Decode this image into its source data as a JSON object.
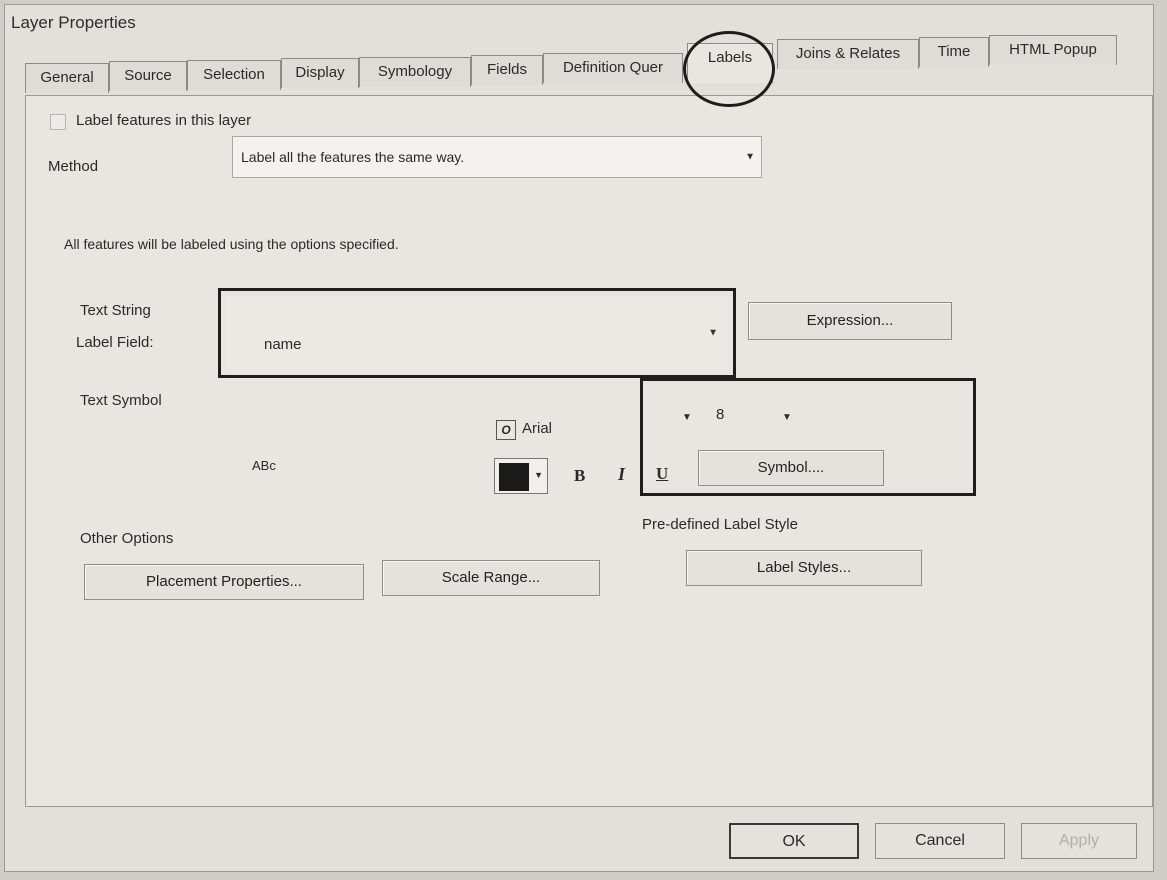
{
  "dialog": {
    "title": "Layer Properties"
  },
  "tabs": [
    {
      "label": "General"
    },
    {
      "label": "Source"
    },
    {
      "label": "Selection"
    },
    {
      "label": "Display"
    },
    {
      "label": "Symbology"
    },
    {
      "label": "Fields"
    },
    {
      "label": "Definition Quer"
    },
    {
      "label": "Labels"
    },
    {
      "label": "Joins & Relates"
    },
    {
      "label": "Time"
    },
    {
      "label": "HTML Popup"
    }
  ],
  "active_tab": "Labels",
  "labels_panel": {
    "label_features_checkbox": {
      "label": "Label features in this layer",
      "checked": false
    },
    "method": {
      "label": "Method",
      "value": "Label all the features the same way."
    },
    "info_text": "All features will be labeled using the options specified.",
    "text_string": {
      "heading": "Text String",
      "label_field_label": "Label Field:",
      "label_field_value": "name",
      "expression_button": "Expression..."
    },
    "text_symbol": {
      "heading": "Text Symbol",
      "preview_text": "ABc",
      "font_icon_glyph": "O",
      "font_name": "Arial",
      "font_size": "8",
      "color": "#1a1a1a",
      "bold_label": "B",
      "italic_label": "I",
      "underline_label": "U",
      "symbol_button": "Symbol...."
    },
    "other_options": {
      "heading": "Other Options",
      "placement_button": "Placement Properties...",
      "scale_range_button": "Scale Range..."
    },
    "predefined": {
      "heading": "Pre-defined Label Style",
      "label_styles_button": "Label Styles..."
    }
  },
  "buttons": {
    "ok": "OK",
    "cancel": "Cancel",
    "apply": "Apply"
  }
}
